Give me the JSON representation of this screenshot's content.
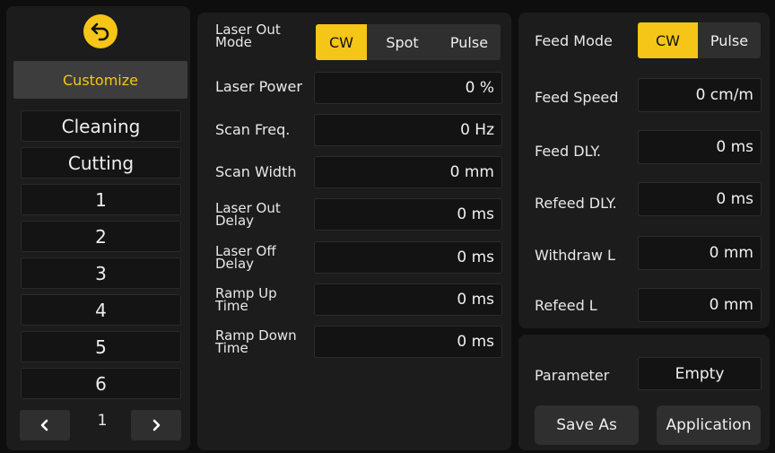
{
  "sidebar": {
    "header": "Customize",
    "items": [
      "Cleaning",
      "Cutting",
      "1",
      "2",
      "3",
      "4",
      "5",
      "6"
    ],
    "page": "1"
  },
  "laser": {
    "mode_label_line1": "Laser Out",
    "mode_label_line2": "Mode",
    "modes": [
      "CW",
      "Spot",
      "Pulse"
    ],
    "selected_mode": "CW",
    "params": [
      {
        "label1": "Laser Power",
        "label2": "",
        "value": "0 %"
      },
      {
        "label1": "Scan Freq.",
        "label2": "",
        "value": "0 Hz"
      },
      {
        "label1": "Scan Width",
        "label2": "",
        "value": "0 mm"
      },
      {
        "label1": "Laser Out",
        "label2": "Delay",
        "value": "0 ms"
      },
      {
        "label1": "Laser Off",
        "label2": "Delay",
        "value": "0 ms"
      },
      {
        "label1": "Ramp Up",
        "label2": "Time",
        "value": "0 ms"
      },
      {
        "label1": "Ramp Down",
        "label2": "Time",
        "value": "0 ms"
      }
    ]
  },
  "feed": {
    "mode_label": "Feed Mode",
    "modes": [
      "CW",
      "Pulse"
    ],
    "selected_mode": "CW",
    "params": [
      {
        "label": "Feed Speed",
        "value": "0 cm/m"
      },
      {
        "label": "Feed DLY.",
        "value": "0 ms"
      },
      {
        "label": "Refeed DLY.",
        "value": "0 ms"
      },
      {
        "label": "Withdraw L",
        "value": "0 mm"
      },
      {
        "label": "Refeed L",
        "value": "0 mm"
      }
    ]
  },
  "parameter": {
    "label": "Parameter",
    "value": "Empty",
    "save_as": "Save As",
    "application": "Application"
  },
  "colors": {
    "accent": "#f5c518",
    "panel": "#1c1c1c",
    "background": "#0e0e0e"
  },
  "icons": {
    "back": "back-arrow-icon",
    "prev": "chevron-left-icon",
    "next": "chevron-right-icon"
  }
}
